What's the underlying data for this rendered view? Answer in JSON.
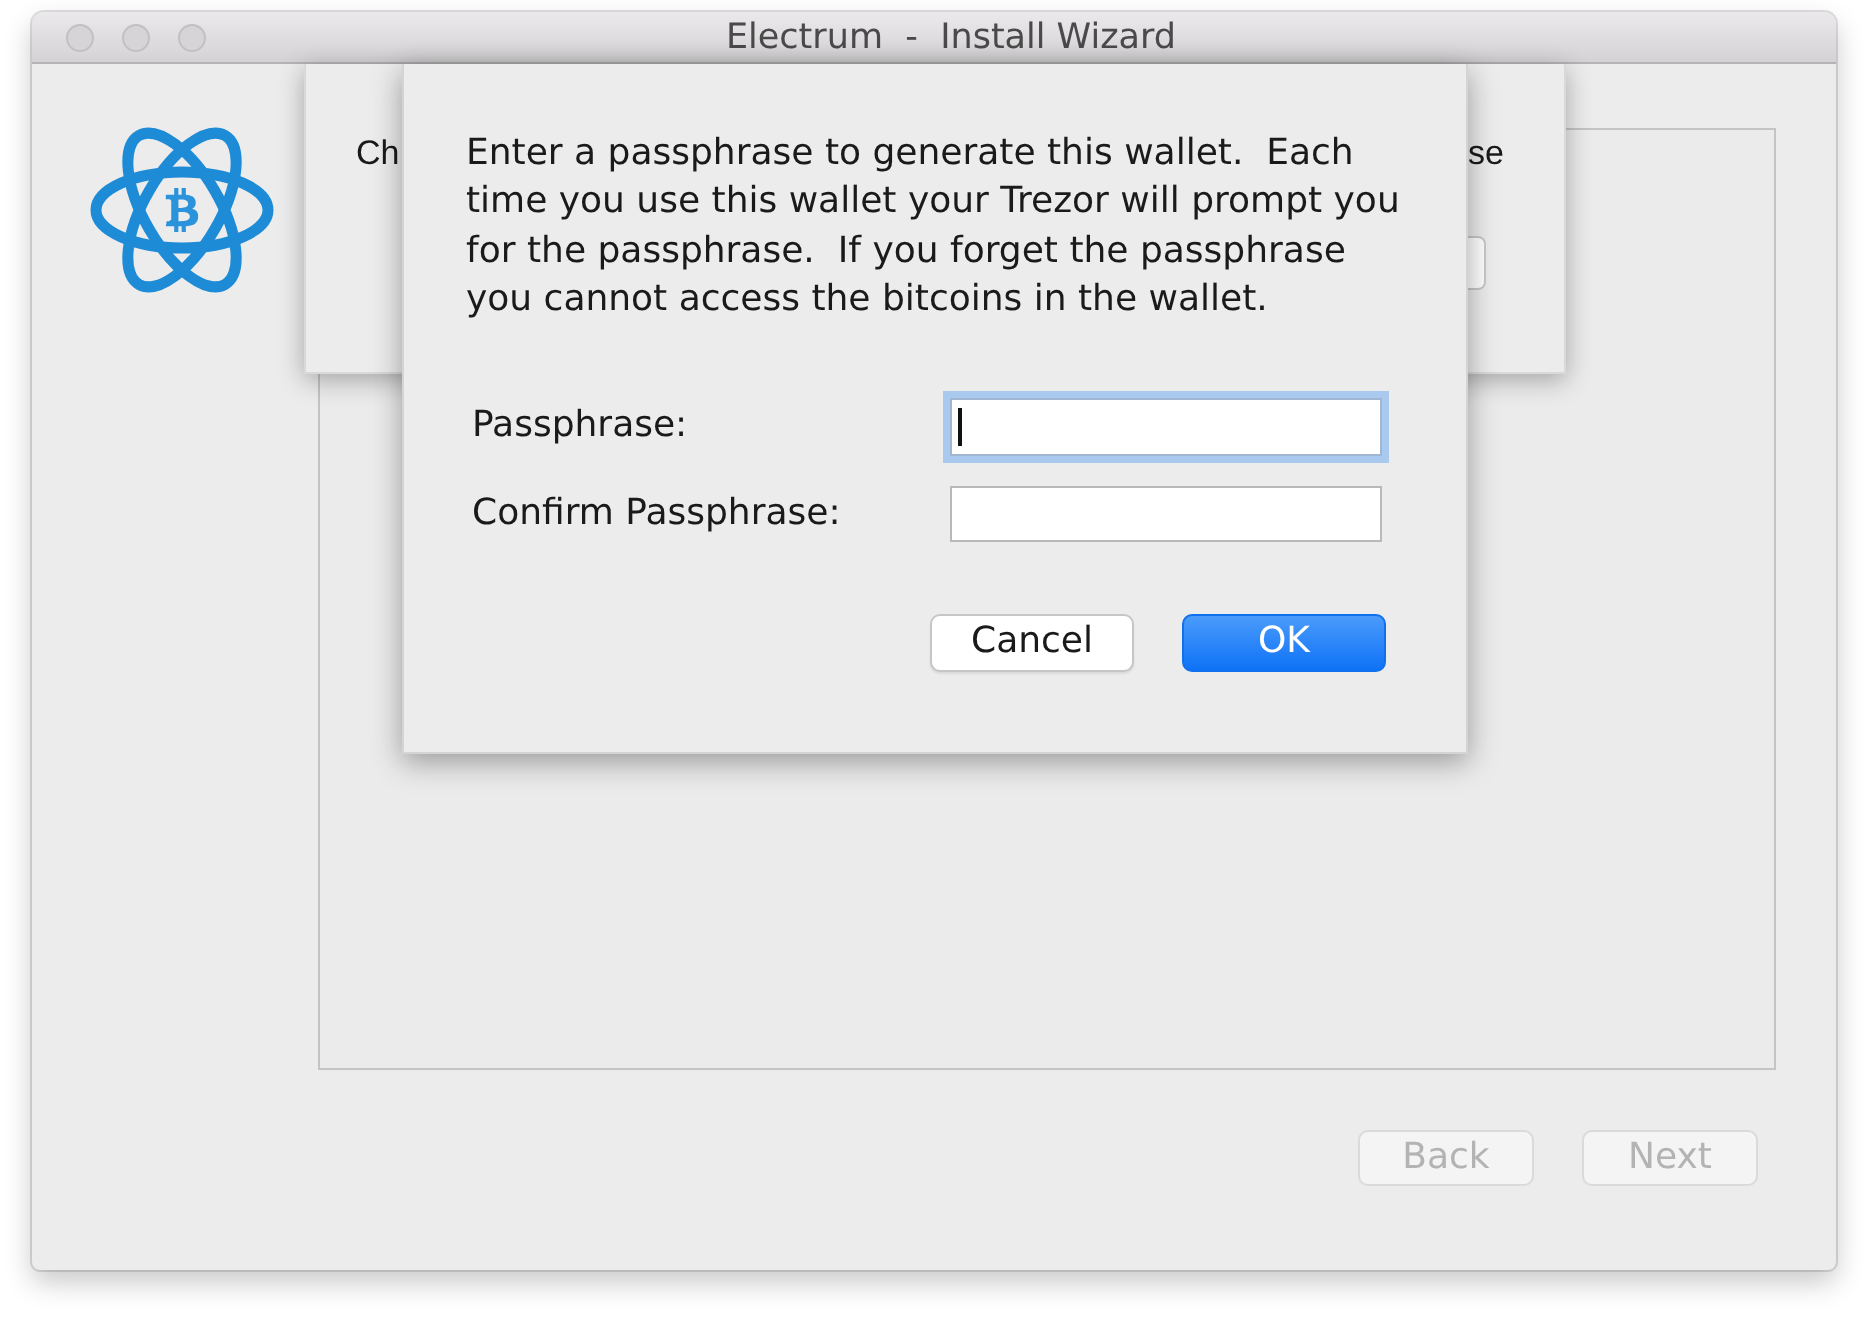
{
  "window": {
    "title": "Electrum  -  Install Wizard"
  },
  "background_dialog": {
    "text_start": "Ch",
    "text_end": "se"
  },
  "dialog": {
    "message": "Enter a passphrase to generate this wallet.  Each time you use this wallet your Trezor will prompt you for the passphrase.  If you forget the passphrase you cannot access the bitcoins in the wallet.",
    "fields": [
      {
        "label": "Passphrase:",
        "focused": true
      },
      {
        "label": "Confirm Passphrase:",
        "focused": false
      }
    ],
    "buttons": [
      {
        "label": "Cancel",
        "default": false
      },
      {
        "label": "OK",
        "default": true
      }
    ]
  },
  "navigation": {
    "buttons": [
      {
        "label": "Back",
        "disabled": true
      },
      {
        "label": "Next",
        "disabled": true
      }
    ]
  }
}
